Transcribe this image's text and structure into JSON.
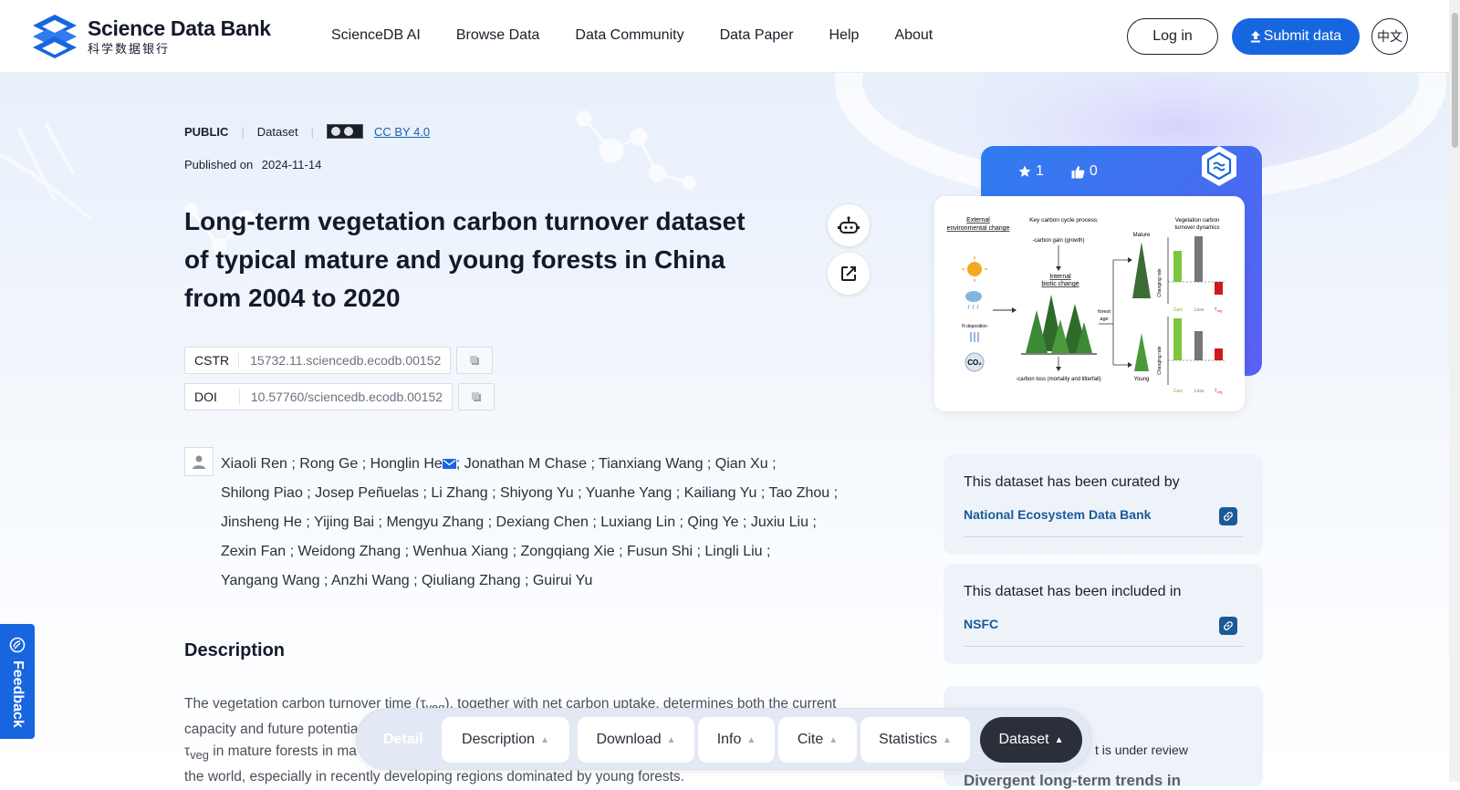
{
  "header": {
    "logo_en": "Science Data Bank",
    "logo_zh": "科学数据银行",
    "nav": [
      "ScienceDB AI",
      "Browse Data",
      "Data Community",
      "Data Paper",
      "Help",
      "About"
    ],
    "login": "Log in",
    "submit": "Submit data",
    "lang": "中文",
    "accent": "#1766e0"
  },
  "dataset": {
    "visibility": "PUBLIC",
    "type": "Dataset",
    "license": "CC BY 4.0",
    "published_label": "Published on",
    "published_date": "2024-11-14",
    "title": "Long-term vegetation carbon turnover dataset of typical mature and young forests in China from 2004 to 2020",
    "cstr_label": "CSTR",
    "cstr": "15732.11.sciencedb.ecodb.00152",
    "doi_label": "DOI",
    "doi": "10.57760/sciencedb.ecodb.00152"
  },
  "authors_lines": [
    "Xiaoli Ren ; Rong Ge ; Honglin He",
    "; Jonathan M Chase ; Tianxiang Wang ; Qian Xu ;",
    "Shilong Piao ; Josep Peñuelas ; Li Zhang ; Shiyong Yu ; Yuanhe Yang ; Kailiang Yu ; Tao Zhou ;",
    "Jinsheng He ; Yijing Bai ; Mengyu Zhang ; Dexiang Chen ; Luxiang Lin ; Qing Ye ; Juxiu Liu ;",
    "Zexin Fan ; Weidong Zhang ; Wenhua Xiang ; Zongqiang Xie ; Fusun Shi ; Lingli Liu ;",
    "Yangang Wang ; Anzhi Wang ; Qiuliang Zhang ; Guirui Yu"
  ],
  "description": {
    "heading": "Description",
    "line1a": "The vegetation carbon turnover time (τ",
    "line1sub": "veg",
    "line1b": "), together with net carbon uptake, determines both the current",
    "line2": "capacity and future potentia",
    "line3a": "τ",
    "line3sub": "veg",
    "line3b": " in mature forests in ma",
    "line4": "the world, especially in recently developing regions dominated by young forests."
  },
  "side": {
    "stars": "1",
    "likes": "0",
    "figure": {
      "external": "External\nenvironmental change",
      "key_process": "Key carbon cycle process:",
      "gain": "-carbon gain (growth)",
      "internal": "Internal\nbiotic change",
      "loss": "-carbon loss (mortality and litterfall)",
      "forest_age": "forest\nage",
      "n_dep": "N deposition",
      "co2": "CO₂",
      "mature": "Mature",
      "young": "Young",
      "dynamics": "Vegetation carbon\nturnover dynamics",
      "axis": "Changing rate",
      "zero": "0",
      "bar_gain": "Gain",
      "bar_loss": "Loss",
      "bar_t": "T",
      "bar_t_sub": "veg"
    },
    "curated_label": "This dataset has been curated by",
    "curated_org": "National Ecosystem Data Bank",
    "included_label": "This dataset has been included in",
    "included_org": "NSFC",
    "review_text": "t is under review",
    "review_title": "Divergent long-term trends in"
  },
  "feedback": "Feedback",
  "footer_bar": {
    "detail": "Detail",
    "items": [
      "Description",
      "Download",
      "Info",
      "Cite",
      "Statistics"
    ],
    "dataset": "Dataset"
  }
}
